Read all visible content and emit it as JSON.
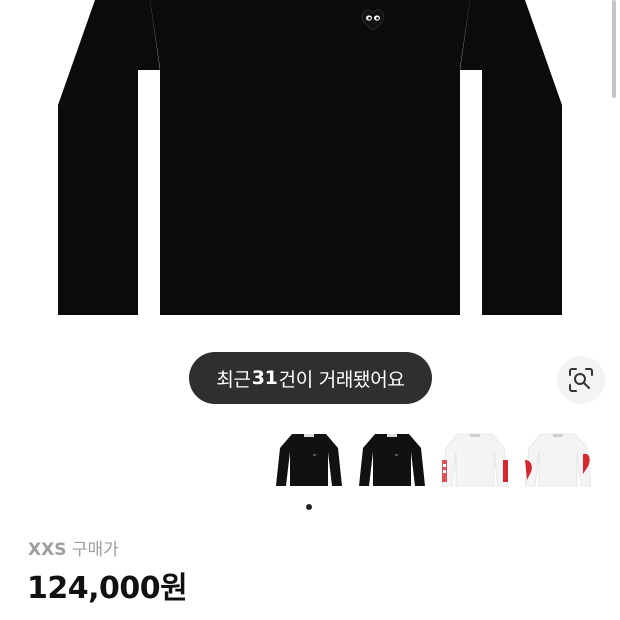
{
  "trade_badge": {
    "prefix": "최근 ",
    "count": "31",
    "suffix": "건이 거래됐어요"
  },
  "lens_button": {
    "icon": "image-search-icon"
  },
  "thumbnails": [
    {
      "shirt_color": "#111111",
      "sleeve_print": false
    },
    {
      "shirt_color": "#111111",
      "sleeve_print": false
    },
    {
      "shirt_color": "#f4f4f4",
      "sleeve_print": true
    },
    {
      "shirt_color": "#f4f4f4",
      "sleeve_print": true
    }
  ],
  "carousel": {
    "active_index": 0
  },
  "purchase": {
    "size": "XXS",
    "label": "구매가",
    "price": "124,000원"
  },
  "colors": {
    "shirt": "#0b0b0b",
    "pill_bg": "#2f2f2f",
    "accent_red": "#d6262e"
  }
}
